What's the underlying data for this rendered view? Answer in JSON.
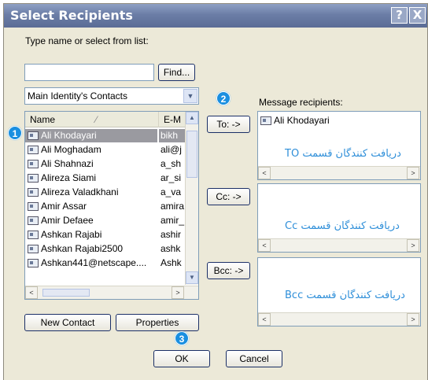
{
  "window": {
    "title": "Select Recipients",
    "help_button": "?",
    "close_button": "X"
  },
  "picker": {
    "prompt": "Type name or select from list:",
    "search_value": "",
    "find_button": "Find...",
    "source_select": "Main Identity's Contacts",
    "columns": [
      "Name",
      "E-M"
    ],
    "contacts": [
      {
        "name": "Ali Khodayari",
        "email": "bikh"
      },
      {
        "name": "Ali Moghadam",
        "email": "ali@j"
      },
      {
        "name": "Ali Shahnazi",
        "email": "a_sh"
      },
      {
        "name": "Alireza Siami",
        "email": "ar_si"
      },
      {
        "name": "Alireza Valadkhani",
        "email": "a_va"
      },
      {
        "name": "Amir Assar",
        "email": "amira"
      },
      {
        "name": "Amir Defaee",
        "email": "amir_"
      },
      {
        "name": "Ashkan Rajabi",
        "email": "ashir"
      },
      {
        "name": "Ashkan Rajabi2500",
        "email": "ashk"
      },
      {
        "name": "Ashkan441@netscape....",
        "email": "Ashk"
      }
    ],
    "new_contact_button": "New Contact",
    "properties_button": "Properties"
  },
  "transfer": {
    "to_button": "To: ->",
    "cc_button": "Cc: ->",
    "bcc_button": "Bcc: ->"
  },
  "recipients": {
    "label": "Message recipients:",
    "to": [
      "Ali Khodayari"
    ],
    "to_caption": "دریافت کنندگان قسمت TO",
    "cc_caption": "دریافت کنندگان قسمت Cc",
    "bcc_caption": "دریافت کنندگان قسمت Bcc"
  },
  "footer": {
    "ok_button": "OK",
    "cancel_button": "Cancel"
  },
  "callouts": [
    "1",
    "2",
    "3"
  ]
}
